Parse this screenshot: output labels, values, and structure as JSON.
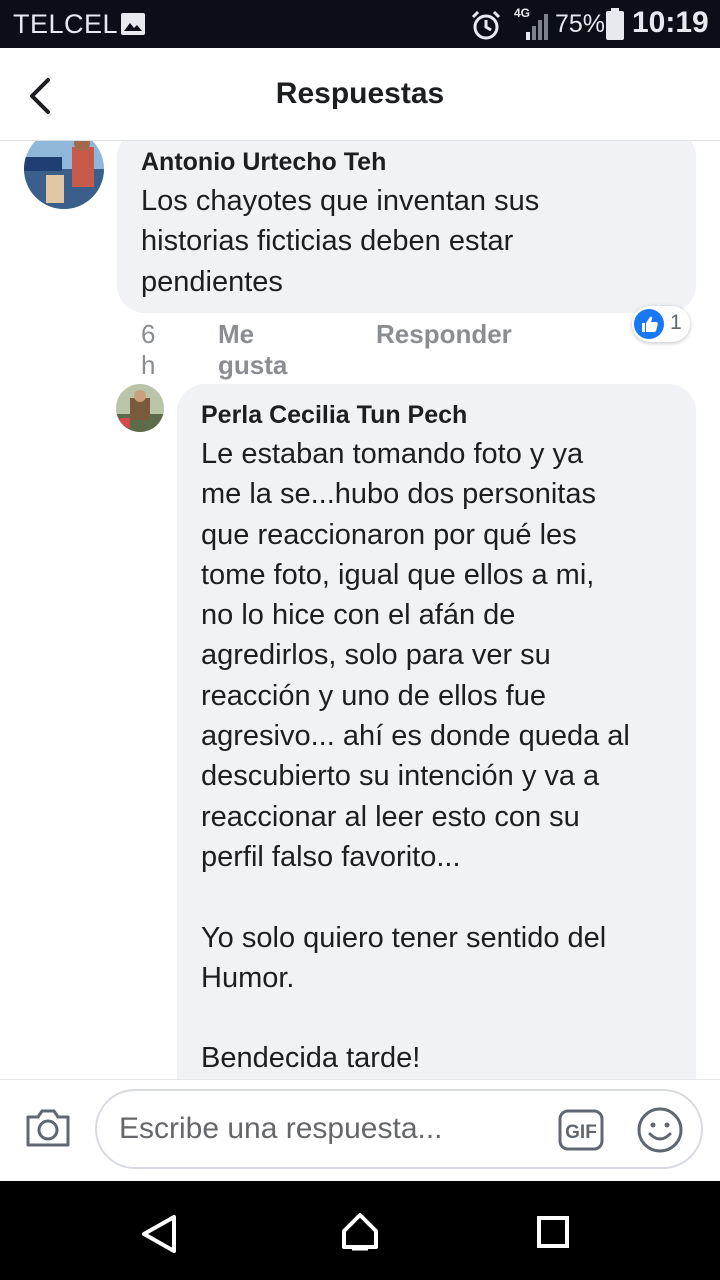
{
  "status_bar": {
    "carrier": "TELCEL",
    "network": "4G",
    "battery": "75%",
    "time": "10:19"
  },
  "header": {
    "title": "Respuestas"
  },
  "comments": [
    {
      "author": "Antonio Urtecho Teh",
      "text": "Los chayotes que inventan sus\nhistorias ficticias deben estar\npendientes",
      "time": "6 h",
      "like_label": "Me gusta",
      "reply_label": "Responder",
      "reaction_count": "1"
    },
    {
      "author": "Perla Cecilia Tun Pech",
      "text": "Le estaban tomando foto y ya\nme la se...hubo dos personitas\nque reaccionaron por qué les\ntome foto, igual que ellos a mi,\nno lo hice con el afán de\nagredirlos, solo para ver su\nreacción y uno de ellos fue\nagresivo... ahí es donde queda al\ndescubierto su intención y va a\nreaccionar al leer esto con su\nperfil falso favorito...\n\nYo solo quiero tener sentido del\nHumor.\n\nBendecida tarde!"
    }
  ],
  "composer": {
    "placeholder": "Escribe una respuesta...",
    "gif_label": "GIF"
  },
  "colors": {
    "status_bar_bg": "#0b0e17",
    "bubble_bg": "#f0f2f5",
    "like_blue": "#1877f2",
    "nav_bg": "#000000"
  },
  "icons": [
    "image-icon",
    "alarm-icon",
    "signal-icon",
    "battery-icon",
    "back-arrow-icon",
    "like-icon",
    "camera-icon",
    "gif-icon",
    "emoji-icon",
    "nav-back-icon",
    "nav-home-icon",
    "nav-recents-icon"
  ]
}
